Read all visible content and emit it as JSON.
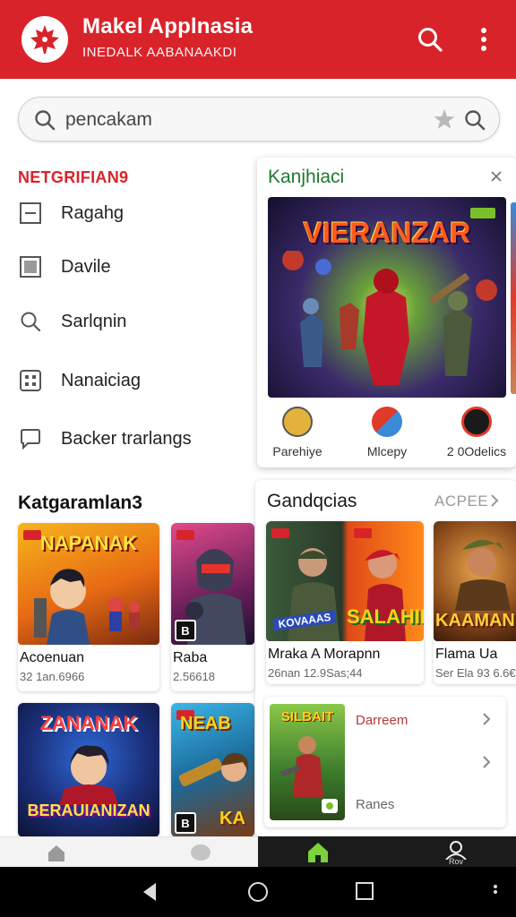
{
  "app": {
    "title": "Makel Applnasia",
    "subtitle": "INEDALK AABANAAKDI",
    "brand_color": "#d9232a",
    "logo_icon": "maple-leaf-icon"
  },
  "search": {
    "value": "pencakam",
    "search_icon": "search-icon",
    "star_icon": "star-icon"
  },
  "drawer": {
    "section_label": "NETGRIFIAN9",
    "items": [
      {
        "label": "Ragahg",
        "icon": "square-minus-icon"
      },
      {
        "label": "Davile",
        "icon": "square-filled-icon"
      },
      {
        "label": "Sarlqnin",
        "icon": "search-icon"
      },
      {
        "label": "Nanaiciag",
        "icon": "grid-icon"
      },
      {
        "label": "Backer trarlangs",
        "icon": "chat-bubble-icon"
      }
    ]
  },
  "left_section": {
    "title": "Katgaramlan3",
    "cards": [
      {
        "title": "Acoenuan",
        "sub": "32 1an.6966",
        "art": "NAPANAK"
      },
      {
        "title": "Raba",
        "sub": "2.56618",
        "art": ""
      },
      {
        "title": "",
        "sub": "",
        "art": "ZANANAK",
        "art2": "BERAUIANIZAN"
      },
      {
        "title": "",
        "sub": "",
        "art": "NEAB",
        "art2": "KA"
      }
    ]
  },
  "featured_panel": {
    "title": "Kanjhiaci",
    "banner_text": "VIERANZAR",
    "categories": [
      {
        "label": "Parehiye",
        "icon": "compass-icon"
      },
      {
        "label": "Mlcepy",
        "icon": "flag-icon"
      },
      {
        "label": "2 0Odelics",
        "icon": "crossed-circle-icon"
      }
    ]
  },
  "games_panel": {
    "title": "Gandqcias",
    "more_label": "ACPEE",
    "cards": [
      {
        "title": "Mraka A Morapnn",
        "sub": "26nan 12.9Sas;44",
        "art": "SALAHIK",
        "art_small": "KOVAAAS"
      },
      {
        "title": "Flama Ua",
        "sub": "Ser Ela  93 6.6€",
        "art": "KAAMAN"
      }
    ]
  },
  "promo_card": {
    "art": "SILBAIT",
    "link_label": "Darreem",
    "footer_label": "Ranes"
  },
  "bottom_nav": {
    "profile_label": "Rov"
  }
}
